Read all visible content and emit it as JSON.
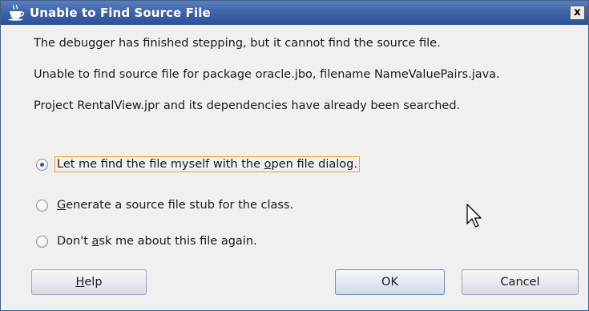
{
  "window": {
    "title": "Unable to Find Source File",
    "title_icon": "coffee-cup-icon",
    "close_symbol": "x"
  },
  "messages": [
    "The debugger has finished stepping, but it cannot find the source file.",
    "Unable to find source file for package oracle.jbo, filename NameValuePairs.java.",
    "Project RentalView.jpr and its dependencies have already been searched."
  ],
  "options": [
    {
      "mnemonic": "o",
      "pre": "Let me find the file myself with the ",
      "m": "o",
      "post": "pen file dialog.",
      "checked": true
    },
    {
      "pre": "",
      "m": "G",
      "post": "enerate a source file stub for the class.",
      "checked": false
    },
    {
      "pre": "Don't ",
      "m": "a",
      "post": "sk me about this file again.",
      "checked": false
    }
  ],
  "buttons": {
    "help": {
      "pre": "",
      "m": "H",
      "post": "elp"
    },
    "ok": "OK",
    "cancel": "Cancel"
  },
  "colors": {
    "title_bar": "#3f64a8",
    "focus_border": "#f0a020",
    "dialog_bg": "#f0f0f0"
  }
}
